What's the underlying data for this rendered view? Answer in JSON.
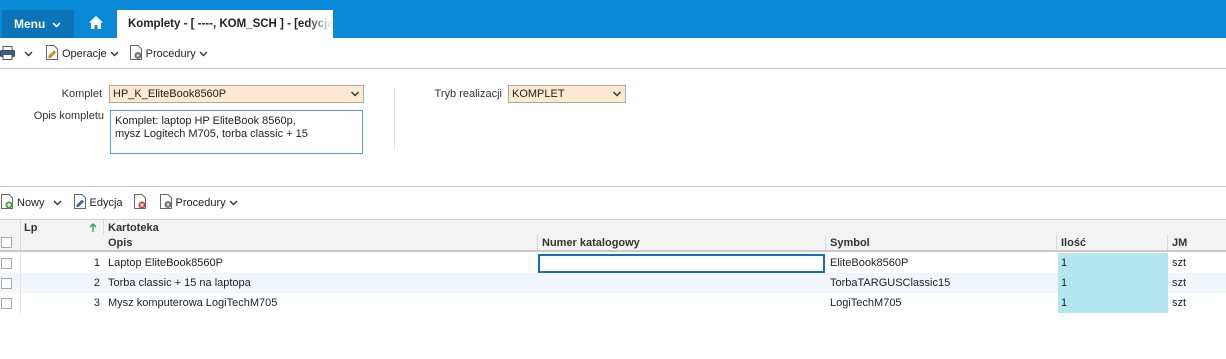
{
  "topbar": {
    "menu_label": "Menu",
    "tab_title": "Komplety - [ ----, KOM_SCH ] - [edycja]"
  },
  "toolbar": {
    "operations_label": "Operacje",
    "procedures_label": "Procedury"
  },
  "form": {
    "komplet_label": "Komplet",
    "komplet_value": "HP_K_EliteBook8560P",
    "opis_label": "Opis kompletu",
    "opis_line1": "Komplet: laptop HP EliteBook 8560p,",
    "opis_line2": "mysz Logitech M705, torba classic + 15",
    "tryb_label": "Tryb realizacji",
    "tryb_value": "KOMPLET"
  },
  "grid_toolbar": {
    "new_label": "Nowy",
    "edit_label": "Edycja",
    "procedures_label": "Procedury"
  },
  "grid": {
    "header_lp": "Lp",
    "header_group": "Kartoteka",
    "header_opis": "Opis",
    "header_numer": "Numer katalogowy",
    "header_symbol": "Symbol",
    "header_ilosc": "Ilość",
    "header_jm": "JM",
    "rows": [
      {
        "lp": "1",
        "opis": "Laptop EliteBook8560P",
        "numer": "",
        "symbol": "EliteBook8560P",
        "ilosc": "1",
        "jm": "szt"
      },
      {
        "lp": "2",
        "opis": "Torba classic + 15 na laptopa",
        "numer": "",
        "symbol": "TorbaTARGUSClassic15",
        "ilosc": "1",
        "jm": "szt"
      },
      {
        "lp": "3",
        "opis": "Mysz komputerowa LogiTechM705",
        "numer": "",
        "symbol": "LogiTechM705",
        "ilosc": "1",
        "jm": "szt"
      }
    ]
  },
  "colors": {
    "topbar": "#0a8ad6",
    "menu_button": "#0b73b8",
    "select_bg": "#fde9cf",
    "qty_bg": "#b3e6ef",
    "focus_border": "#1272b5"
  }
}
